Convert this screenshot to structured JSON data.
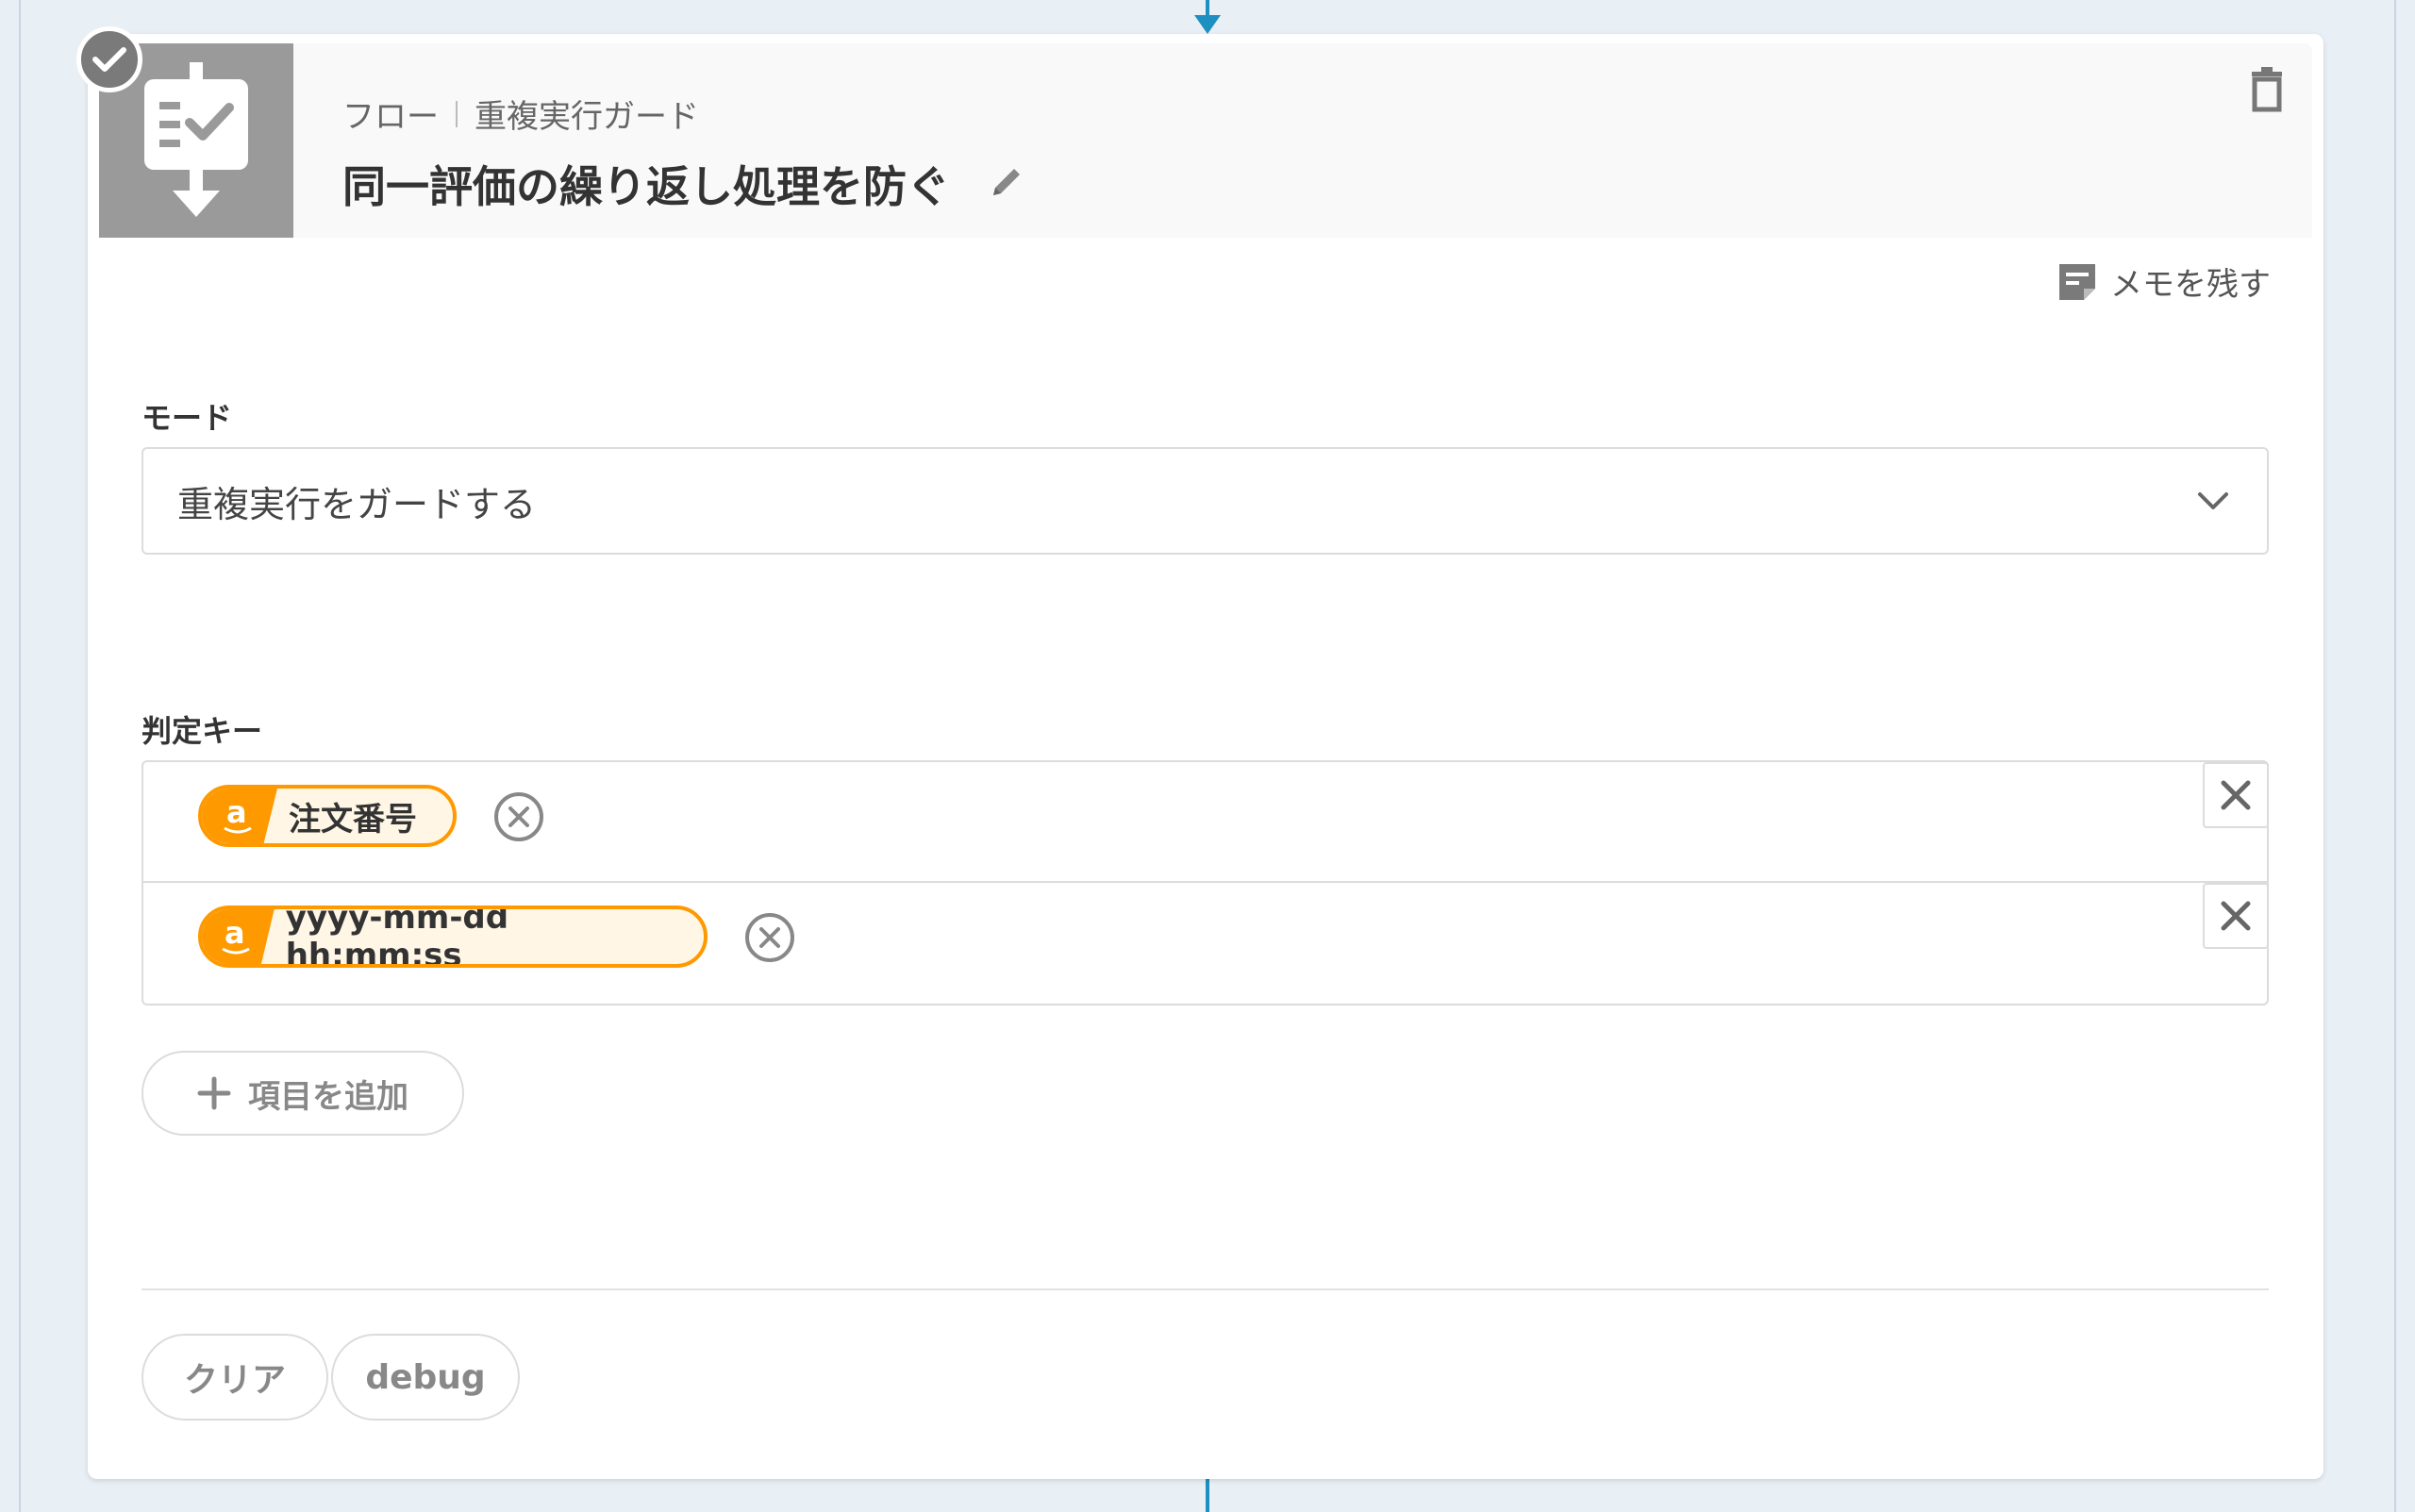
{
  "header": {
    "breadcrumb_root": "フロー",
    "breadcrumb_current": "重複実行ガード",
    "title": "同一評価の繰り返し処理を防ぐ"
  },
  "memo": {
    "label": "メモを残す"
  },
  "mode": {
    "label": "モード",
    "selected": "重複実行をガードする"
  },
  "keys": {
    "label": "判定キー",
    "items": [
      {
        "icon": "amazon-icon",
        "glyph": "a",
        "text": "注文番号"
      },
      {
        "icon": "amazon-icon",
        "glyph": "a",
        "text": "yyyy-mm-dd hh:mm:ss"
      }
    ],
    "add_label": "項目を追加"
  },
  "footer": {
    "clear_label": "クリア",
    "debug_label": "debug"
  },
  "colors": {
    "accent": "#1e8fc1",
    "amazon": "#ff9900",
    "pill_bg": "#fff6e6",
    "header_icon_bg": "#9a9a9a"
  }
}
